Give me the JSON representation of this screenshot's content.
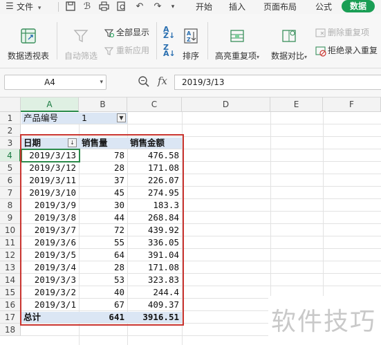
{
  "menu": {
    "file_label": "文件",
    "tabs": [
      "开始",
      "插入",
      "页面布局",
      "公式",
      "数据"
    ],
    "active_tab": "数据"
  },
  "ribbon": {
    "pivot_table": "数据透视表",
    "auto_filter": "自动筛选",
    "show_all": "全部显示",
    "reapply": "重新应用",
    "sort": "排序",
    "highlight_duplicates": "高亮重复项",
    "data_compare": "数据对比",
    "delete_duplicates": "删除重复项",
    "reject_duplicates": "拒绝录入重复"
  },
  "formula_bar": {
    "name_box": "A4",
    "fx": "fx",
    "value": "2019/3/13"
  },
  "columns": [
    "A",
    "B",
    "C",
    "D",
    "E",
    "F"
  ],
  "rows": [
    "1",
    "2",
    "3",
    "4",
    "5",
    "6",
    "7",
    "8",
    "9",
    "10",
    "11",
    "12",
    "13",
    "14",
    "15",
    "16",
    "17",
    "18"
  ],
  "pivot": {
    "filter_label": "产品编号",
    "filter_value": "1",
    "headers": [
      "日期",
      "销售量",
      "销售金额"
    ],
    "records": [
      {
        "date": "2019/3/13",
        "qty": "78",
        "amount": "476.58"
      },
      {
        "date": "2019/3/12",
        "qty": "28",
        "amount": "171.08"
      },
      {
        "date": "2019/3/11",
        "qty": "37",
        "amount": "226.07"
      },
      {
        "date": "2019/3/10",
        "qty": "45",
        "amount": "274.95"
      },
      {
        "date": "2019/3/9",
        "qty": "30",
        "amount": "183.3"
      },
      {
        "date": "2019/3/8",
        "qty": "44",
        "amount": "268.84"
      },
      {
        "date": "2019/3/7",
        "qty": "72",
        "amount": "439.92"
      },
      {
        "date": "2019/3/6",
        "qty": "55",
        "amount": "336.05"
      },
      {
        "date": "2019/3/5",
        "qty": "64",
        "amount": "391.04"
      },
      {
        "date": "2019/3/4",
        "qty": "28",
        "amount": "171.08"
      },
      {
        "date": "2019/3/3",
        "qty": "53",
        "amount": "323.83"
      },
      {
        "date": "2019/3/2",
        "qty": "40",
        "amount": "244.4"
      },
      {
        "date": "2019/3/1",
        "qty": "67",
        "amount": "409.37"
      }
    ],
    "total_label": "总计",
    "total_qty": "641",
    "total_amount": "3916.51"
  },
  "watermark": "软件技巧",
  "colors": {
    "accent": "#1a9e55",
    "highlight_box": "#c9342f",
    "pivot_band": "#dbe6f4",
    "active_cell": "#2a8a4a"
  }
}
